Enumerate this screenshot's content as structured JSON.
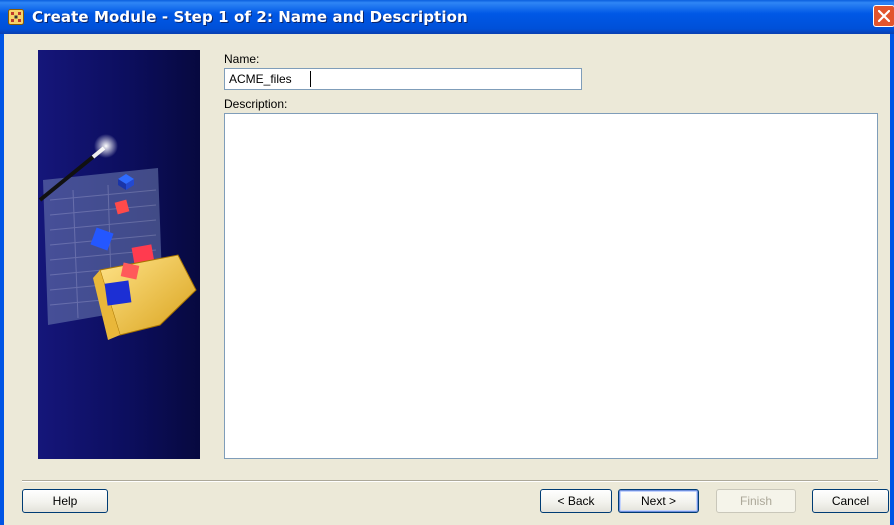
{
  "window": {
    "title": "Create Module - Step 1 of 2: Name and Description",
    "app_icon": "wizard-app-icon",
    "close_icon": "close-icon"
  },
  "form": {
    "name_label": "Name:",
    "name_value": "ACME_files",
    "description_label": "Description:",
    "description_value": ""
  },
  "buttons": {
    "help": "Help",
    "back": "< Back",
    "next": "Next >",
    "finish": "Finish",
    "cancel": "Cancel"
  },
  "illustration": "wizard-folder-illustration",
  "colors": {
    "titlebar": "#0058e6",
    "close_button": "#e2552d",
    "dialog_background": "#ece9d8",
    "illustration_background": "#0c0e5e",
    "disabled_text": "#aca899"
  }
}
